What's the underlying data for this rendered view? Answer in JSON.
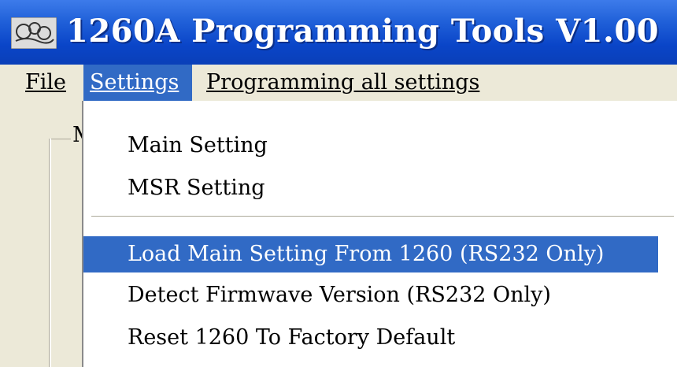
{
  "window": {
    "title": "1260A Programming Tools V1.00",
    "app_icon": "app-logo-icon"
  },
  "menubar": {
    "file": "File",
    "settings": "Settings",
    "programming_all": "Programming all settings"
  },
  "background": {
    "groupbox_letter": "M"
  },
  "settings_menu": {
    "items": [
      "Main Setting",
      "MSR Setting",
      "Load Main Setting From 1260 (RS232 Only)",
      "Detect Firmwave Version (RS232 Only)",
      "Reset 1260 To Factory Default"
    ],
    "highlighted_index": 2
  },
  "colors": {
    "titlebar": "#0a45c8",
    "menu_highlight": "#316ac5",
    "chrome": "#ece9d8"
  }
}
